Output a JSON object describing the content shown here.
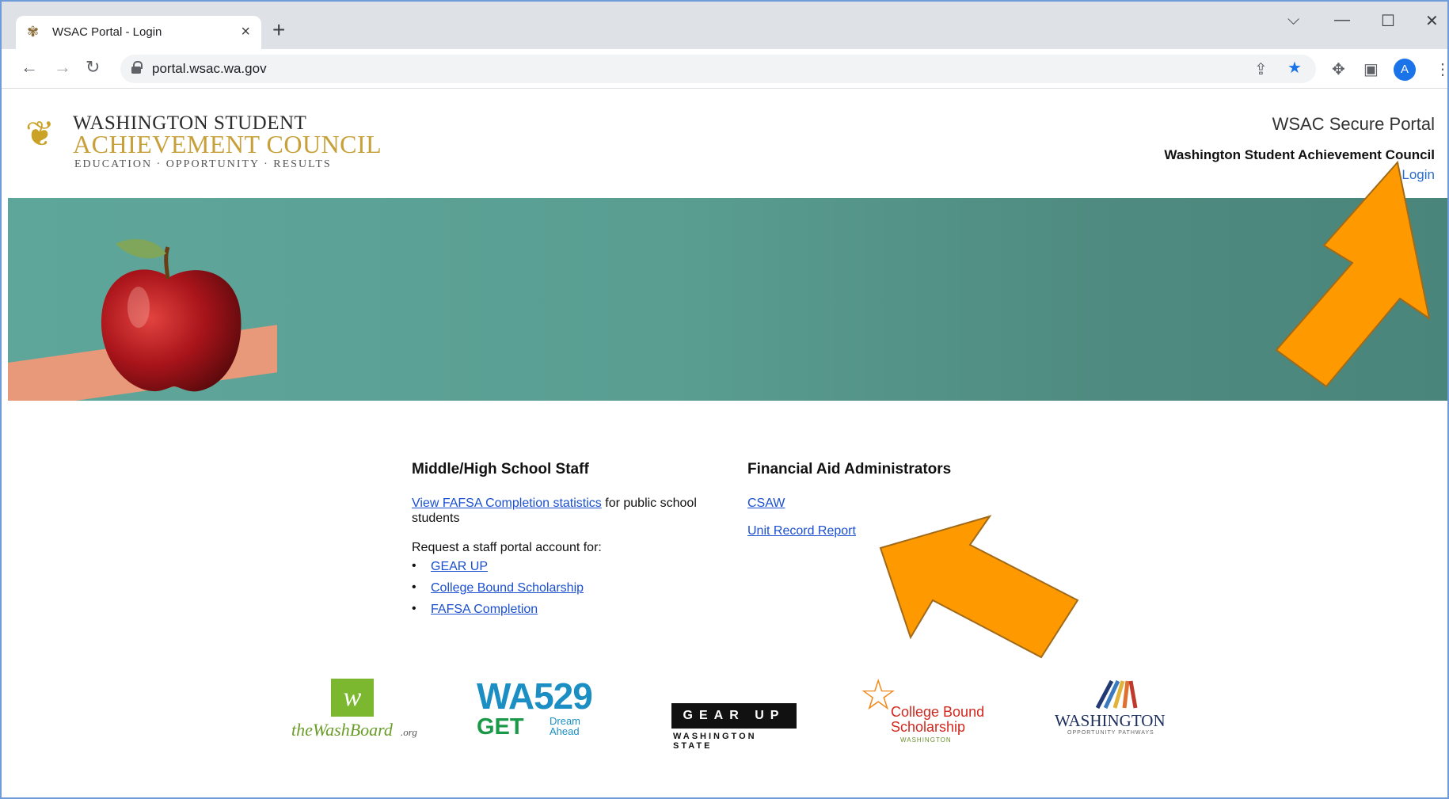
{
  "browser": {
    "tab_title": "WSAC Portal - Login",
    "new_tab": "+",
    "url": "portal.wsac.wa.gov",
    "profile_initial": "A"
  },
  "header": {
    "logo_line1": "WASHINGTON STUDENT",
    "logo_line2": "ACHIEVEMENT COUNCIL",
    "logo_line3": "EDUCATION · OPPORTUNITY · RESULTS",
    "portal_title": "WSAC Secure Portal",
    "org_name": "Washington Student Achievement Council",
    "login_label": "Login"
  },
  "left_section": {
    "heading": "Middle/High School Staff",
    "fafsa_link": "View FAFSA Completion statistics",
    "fafsa_suffix": "for public school students",
    "request_text": "Request a staff portal account for:",
    "items": [
      "GEAR UP",
      "College Bound Scholarship",
      "FAFSA Completion"
    ]
  },
  "right_section": {
    "heading": "Financial Aid Administrators",
    "links": [
      "CSAW",
      "Unit Record Report"
    ]
  },
  "partner_logos": {
    "washboard_main": "theWashBoard",
    "washboard_suffix": ".org",
    "wa529_top": "WA529",
    "wa529_get": "GET",
    "wa529_dream": "Dream Ahead",
    "gearup_main": "GEAR UP",
    "gearup_sub": "WASHINGTON STATE",
    "cbs_main": "College Bound Scholarship",
    "cbs_sub": "WASHINGTON",
    "wop_main": "WASHINGTON",
    "wop_sub": "OPPORTUNITY PATHWAYS"
  },
  "colors": {
    "arrow": "#ff9900",
    "link": "#1a4fd0",
    "hero": "#5a9e92"
  }
}
